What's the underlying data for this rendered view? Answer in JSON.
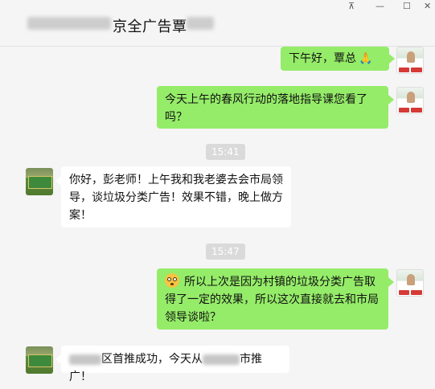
{
  "window": {
    "title": "京全广告覃",
    "controls": {
      "pin": "⊼",
      "minimize": "—",
      "maximize": "☐",
      "close": "✕"
    }
  },
  "colors": {
    "bubble_me": "#95ec69",
    "bubble_them": "#ffffff",
    "chat_bg": "#f5f5f5",
    "time_badge": "#dadada"
  },
  "messages": [
    {
      "from": "me",
      "text": "下午好，覃总",
      "emoji": "praying-hands"
    },
    {
      "from": "me",
      "text": "今天上午的春风行动的落地指导课您看了吗？"
    },
    {
      "type": "time",
      "text": "15:41"
    },
    {
      "from": "them",
      "text": "你好，彭老师！上午我和我老婆去会市局领导，谈垃圾分类广告！效果不错，晚上做方案！"
    },
    {
      "type": "time",
      "text": "15:47"
    },
    {
      "from": "me",
      "emoji": "flushed-face",
      "text": "所以上次是因为村镇的垃圾分类广告取得了一定的效果，所以这次直接就去和市局领导谈啦？"
    },
    {
      "from": "them",
      "parts": [
        "区首推成功，今天从",
        "市推广！"
      ]
    }
  ]
}
